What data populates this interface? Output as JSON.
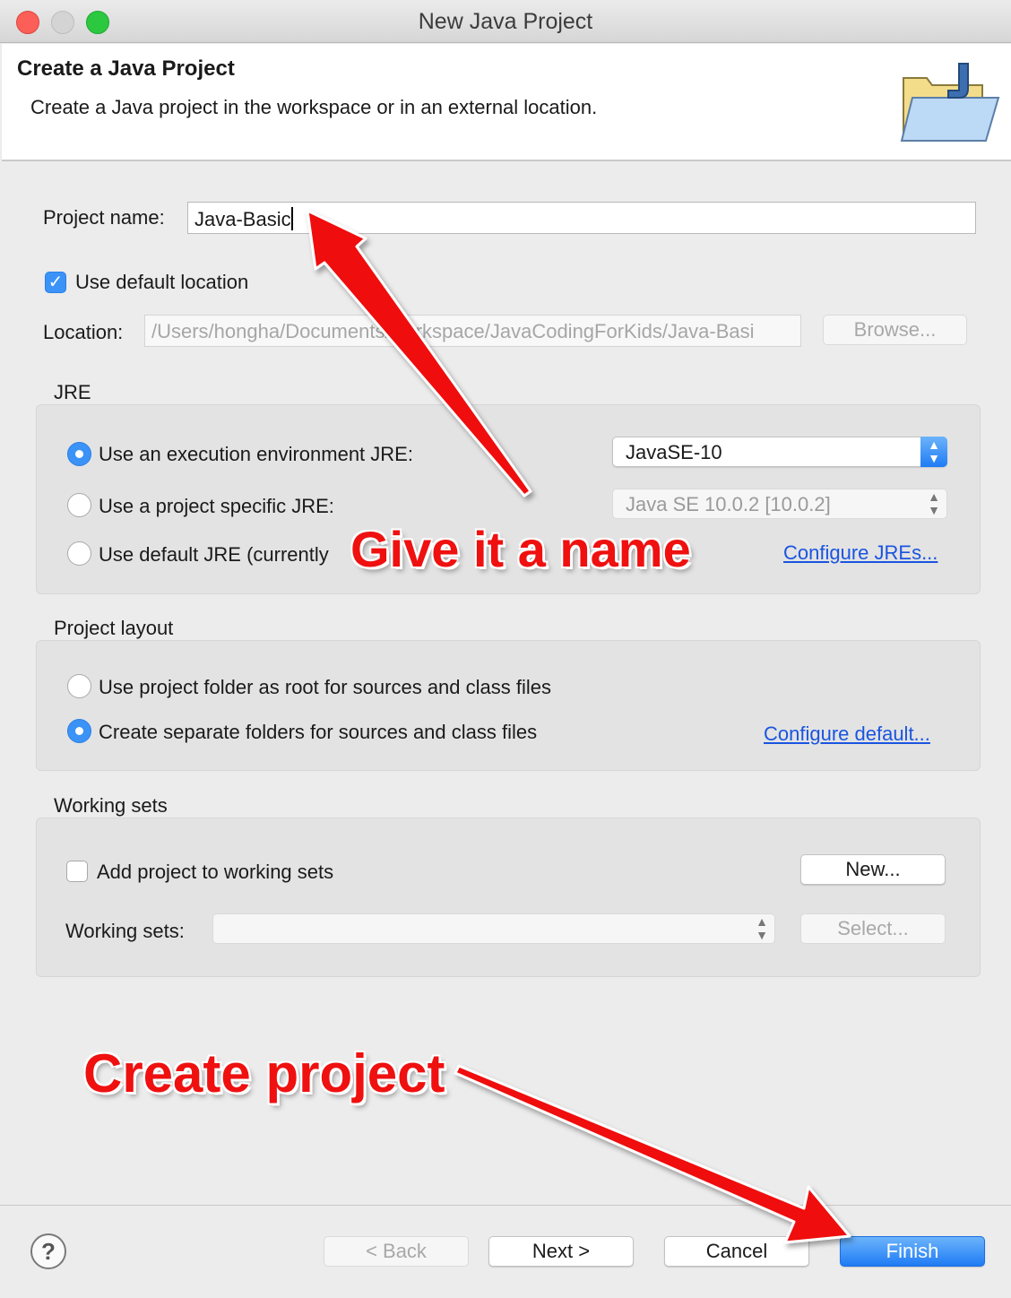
{
  "window": {
    "title": "New Java Project"
  },
  "header": {
    "title": "Create a Java Project",
    "description": "Create a Java project in the workspace or in an external location."
  },
  "project": {
    "name_label": "Project name:",
    "name_value": "Java-Basic",
    "use_default_location_label": "Use default location",
    "use_default_location_checked": true,
    "location_label": "Location:",
    "location_value": "/Users/hongha/Documents/workspace/JavaCodingForKids/Java-Basi",
    "browse_label": "Browse..."
  },
  "jre": {
    "group_label": "JRE",
    "option_env_label": "Use an execution environment JRE:",
    "option_env_value": "JavaSE-10",
    "option_specific_label": "Use a project specific JRE:",
    "option_specific_value": "Java SE 10.0.2 [10.0.2]",
    "option_default_label": "Use default JRE (currently",
    "configure_link": "Configure JREs..."
  },
  "layout": {
    "group_label": "Project layout",
    "option_root_label": "Use project folder as root for sources and class files",
    "option_separate_label": "Create separate folders for sources and class files",
    "configure_link": "Configure default..."
  },
  "working_sets": {
    "group_label": "Working sets",
    "add_label": "Add project to working sets",
    "new_button": "New...",
    "sets_label": "Working sets:",
    "select_button": "Select..."
  },
  "footer": {
    "help_icon": "?",
    "back_button": "< Back",
    "next_button": "Next >",
    "cancel_button": "Cancel",
    "finish_button": "Finish"
  },
  "annotations": {
    "name_hint": "Give it a name",
    "create_hint": "Create project"
  },
  "colors": {
    "accent": "#3b93f7",
    "annotation_red": "#ef1010"
  }
}
